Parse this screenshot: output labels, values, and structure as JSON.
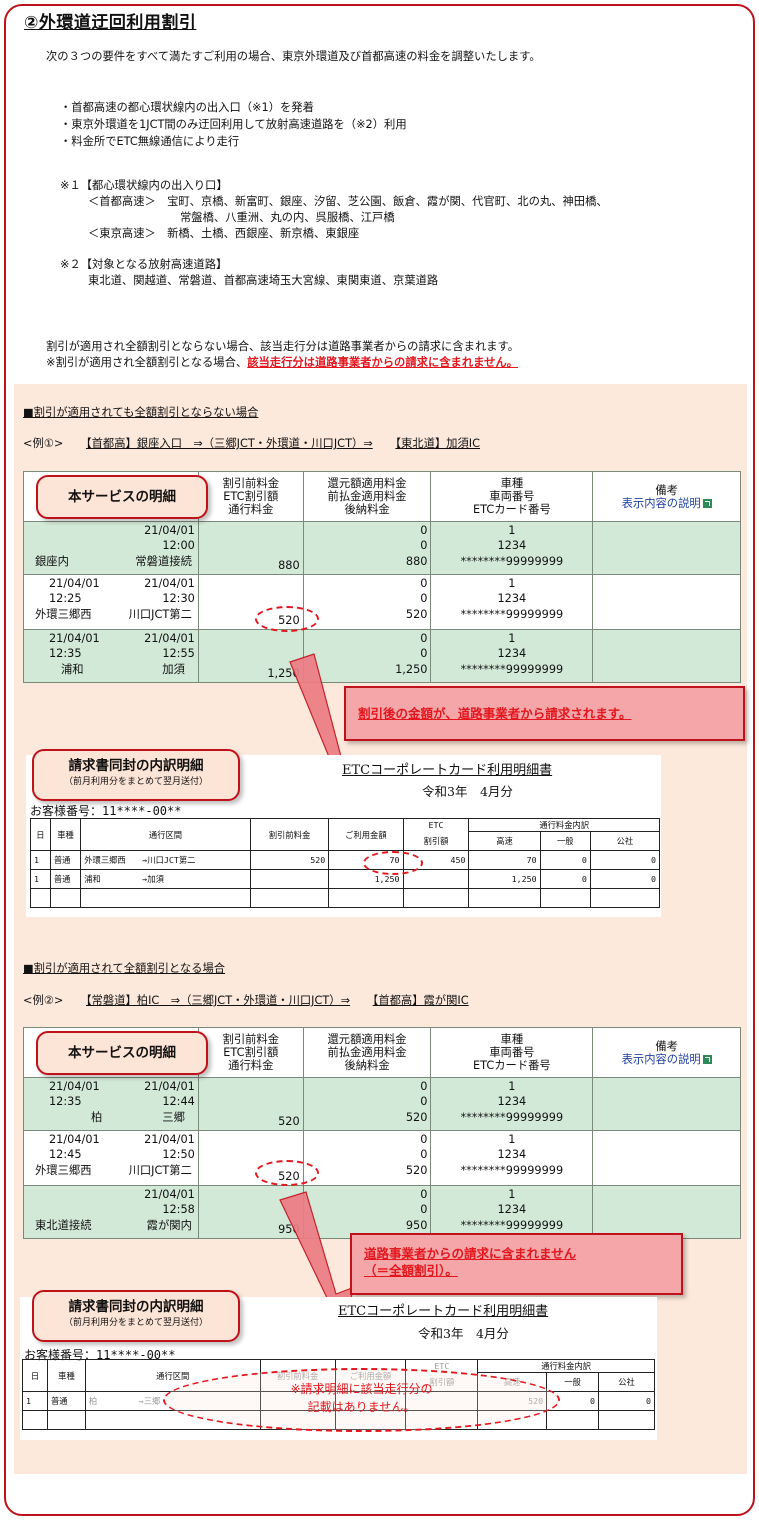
{
  "title": "②外環道迂回利用割引",
  "intro": "次の３つの要件をすべて満たすご利用の場合、東京外環道及び首都高速の料金を調整いたします。",
  "requirements": [
    "・首都高速の都心環状線内の出入口（※1）を発着",
    "・東京外環道を1JCT間のみ迂回利用して放射高速道路を（※2）利用",
    "・料金所でETC無線通信により走行"
  ],
  "note1": {
    "head": "※１【都心環状線内の出入り口】",
    "l1": "＜首都高速＞　宝町、京橋、新富町、銀座、汐留、芝公園、飯倉、霞が関、代官町、北の丸、神田橋、",
    "l2": "常盤橋、八重洲、丸の内、呉服橋、江戸橋",
    "l3": "＜東京高速＞　新橋、土橋、西銀座、新京橋、東銀座"
  },
  "note2": {
    "head": "※２【対象となる放射高速道路】",
    "l1": "東北道、関越道、常磐道、首都高速埼玉大宮線、東関東道、京葉道路"
  },
  "footer1": "割引が適用され全額割引とならない場合、該当走行分は道路事業者からの請求に含まれます。",
  "footer2_pre": "※割引が適用され全額割引となる場合、",
  "footer2_red": "該当走行分は道路事業者からの請求に含まれません。",
  "sec1": {
    "heading": "■割引が適用されても全額割引とならない場合",
    "example_label": "<例①>",
    "route_a": "【首都高】銀座入口　⇒（三郷JCT・外環道・川口JCT）⇒",
    "route_b": "【東北道】加須IC",
    "header": {
      "c2": [
        "割引前料金",
        "ETC割引額",
        "通行料金"
      ],
      "c3": [
        "還元額適用料金",
        "前払金適用料金",
        "後納料金"
      ],
      "c4": [
        "車種",
        "車両番号",
        "ETCカード番号"
      ],
      "c5a": "備考",
      "c5b": "表示内容の説明"
    },
    "rows": [
      {
        "in_date": "",
        "in_time": "",
        "out_date": "21/04/01",
        "out_time": "12:00",
        "from": "銀座内",
        "to": "常磐道接続",
        "fee": "880",
        "v1": "0",
        "v2": "0",
        "v3": "880",
        "car": "1",
        "num": "1234",
        "card": "********99999999"
      },
      {
        "in_date": "21/04/01",
        "in_time": "12:25",
        "out_date": "21/04/01",
        "out_time": "12:30",
        "from": "外環三郷西",
        "to": "川口JCT第二",
        "fee": "520",
        "v1": "0",
        "v2": "0",
        "v3": "520",
        "car": "1",
        "num": "1234",
        "card": "********99999999"
      },
      {
        "in_date": "21/04/01",
        "in_time": "12:35",
        "out_date": "21/04/01",
        "out_time": "12:55",
        "from": "浦和",
        "to": "加須",
        "fee": "1,250",
        "v1": "0",
        "v2": "0",
        "v3": "1,250",
        "car": "1",
        "num": "1234",
        "card": "********99999999"
      }
    ],
    "bubble": "本サービスの明細",
    "callout": "割引後の金額が、道路事業者から請求されます。",
    "inv_bubble1": "請求書同封の内訳明細",
    "inv_bubble2": "（前月利用分をまとめて翌月送付）",
    "inv_title": "ETCコーポレートカード利用明細書",
    "inv_month": "令和3年　4月分",
    "inv_cust": "お客様番号：11****-00**",
    "inv_head": [
      "日",
      "車種",
      "通行区間",
      "割引前料金",
      "ご利用金額",
      "ETC",
      "割引額",
      "通行料金内訳",
      "高速",
      "一般",
      "公社"
    ],
    "inv_rows": [
      {
        "d": "1",
        "t": "普通",
        "route": "外環三郷西　　→川口JCT第二",
        "pre": "520",
        "amt": "70",
        "disc": "450",
        "hw": "70",
        "gen": "0",
        "pub": "0"
      },
      {
        "d": "1",
        "t": "普通",
        "route": "浦和　　　　　→加須",
        "pre": "",
        "amt": "1,250",
        "disc": "",
        "hw": "1,250",
        "gen": "0",
        "pub": "0"
      }
    ]
  },
  "sec2": {
    "heading": "■割引が適用されて全額割引となる場合",
    "example_label": "<例②>",
    "route_a": "【常磐道】柏IC　⇒（三郷JCT・外環道・川口JCT）⇒",
    "route_b": "【首都高】霞が関IC",
    "rows": [
      {
        "in_date": "21/04/01",
        "in_time": "12:35",
        "out_date": "21/04/01",
        "out_time": "12:44",
        "from": "柏",
        "to": "三郷",
        "fee": "520",
        "v1": "0",
        "v2": "0",
        "v3": "520",
        "car": "1",
        "num": "1234",
        "card": "********99999999"
      },
      {
        "in_date": "21/04/01",
        "in_time": "12:45",
        "out_date": "21/04/01",
        "out_time": "12:50",
        "from": "外環三郷西",
        "to": "川口JCT第二",
        "fee": "520",
        "v1": "0",
        "v2": "0",
        "v3": "520",
        "car": "1",
        "num": "1234",
        "card": "********99999999"
      },
      {
        "in_date": "",
        "in_time": "",
        "out_date": "21/04/01",
        "out_time": "12:58",
        "from": "東北道接続",
        "to": "霞が関内",
        "fee": "950",
        "v1": "0",
        "v2": "0",
        "v3": "950",
        "car": "1",
        "num": "1234",
        "card": "********99999999"
      }
    ],
    "callout_l1": "道路事業者からの請求に含まれません",
    "callout_l2": "（＝全額割引）。",
    "inv_route": "柏　　　　　→三郷",
    "inv_hw": "520",
    "inv_gen": "0",
    "inv_pub": "0",
    "none_l1": "※請求明細に該当走行分の",
    "none_l2": "記載はありません。"
  }
}
